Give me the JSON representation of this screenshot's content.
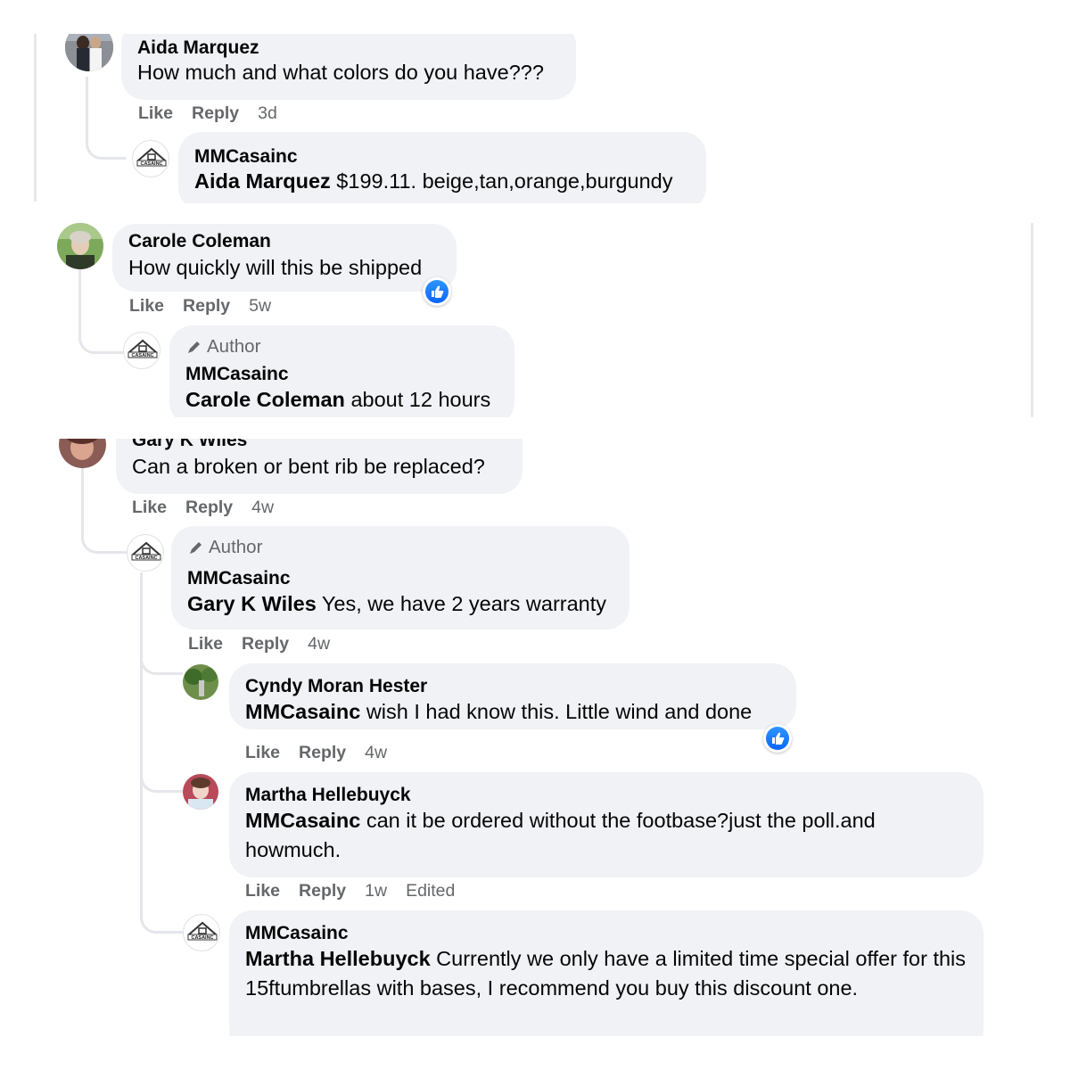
{
  "actions": {
    "like": "Like",
    "reply": "Reply"
  },
  "author_label": "Author",
  "comments": {
    "aida": {
      "name": "Aida Marquez",
      "text": "How much and what colors do you have???",
      "time": "3d"
    },
    "aida_reply": {
      "name": "MMCasainc",
      "mention": "Aida Marquez",
      "text": " $199.11. beige,tan,orange,burgundy"
    },
    "carole": {
      "name": "Carole Coleman",
      "text": "How quickly will this be shipped",
      "time": "5w"
    },
    "carole_reply": {
      "name": "MMCasainc",
      "mention": "Carole Coleman",
      "text": " about 12 hours"
    },
    "gary": {
      "name": "Gary K Wiles",
      "text": "Can a broken or bent rib be replaced?",
      "time": "4w"
    },
    "gary_reply": {
      "name": "MMCasainc",
      "mention": "Gary K Wiles",
      "text": " Yes, we have 2 years warranty",
      "time": "4w"
    },
    "cyndy": {
      "name": "Cyndy Moran Hester",
      "mention": "MMCasainc",
      "text": " wish I had know this. Little wind and done",
      "time": "4w"
    },
    "martha": {
      "name": "Martha Hellebuyck",
      "mention": "MMCasainc",
      "text": " can it be ordered without the footbase?just the poll.and howmuch.",
      "time": "1w",
      "edited": "Edited"
    },
    "martha_reply": {
      "name": "MMCasainc",
      "mention": "Martha Hellebuyck",
      "text": " Currently we only have a limited time special offer for this 15ftumbrellas with bases, I recommend you buy this discount one."
    }
  },
  "logo_text": "CASAINC",
  "colors": {
    "bubble": "#f0f2f5",
    "like_blue": "#0866ff",
    "secondary_text": "#65676b"
  }
}
